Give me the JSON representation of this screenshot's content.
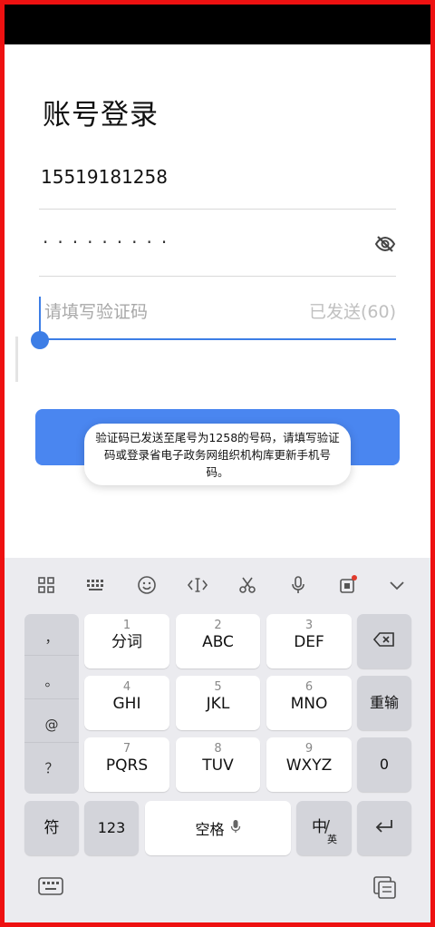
{
  "page": {
    "title": "账号登录"
  },
  "form": {
    "phone_value": "15519181258",
    "password_mask": "·········",
    "code_placeholder": "请填写验证码",
    "resend_label": "已发送(60)"
  },
  "toast": {
    "message": "验证码已发送至尾号为1258的号码，请填写验证码或登录省电子政务网组织机构库更新手机号码。"
  },
  "colors": {
    "accent": "#3d7ee6",
    "button": "#4a86f0",
    "frame": "#ee1111"
  },
  "keyboard": {
    "toolbar_icons": [
      "grid-icon",
      "keyboard-icon",
      "emoji-icon",
      "cursor-move-icon",
      "scissors-icon",
      "microphone-icon",
      "clipboard-icon",
      "chevron-down-icon"
    ],
    "punct_column": [
      "，",
      "。",
      "@",
      "？"
    ],
    "keys_row1": [
      {
        "num": "1",
        "label": "分词"
      },
      {
        "num": "2",
        "label": "ABC"
      },
      {
        "num": "3",
        "label": "DEF"
      }
    ],
    "keys_row2": [
      {
        "num": "4",
        "label": "GHI"
      },
      {
        "num": "5",
        "label": "JKL"
      },
      {
        "num": "6",
        "label": "MNO"
      }
    ],
    "keys_row3": [
      {
        "num": "7",
        "label": "PQRS"
      },
      {
        "num": "8",
        "label": "TUV"
      },
      {
        "num": "9",
        "label": "WXYZ"
      }
    ],
    "retype_label": "重输",
    "zero_label": "0",
    "symbol_label": "符",
    "num123_label": "123",
    "space_label": "空格",
    "lang_main": "中",
    "lang_sub": "英"
  }
}
